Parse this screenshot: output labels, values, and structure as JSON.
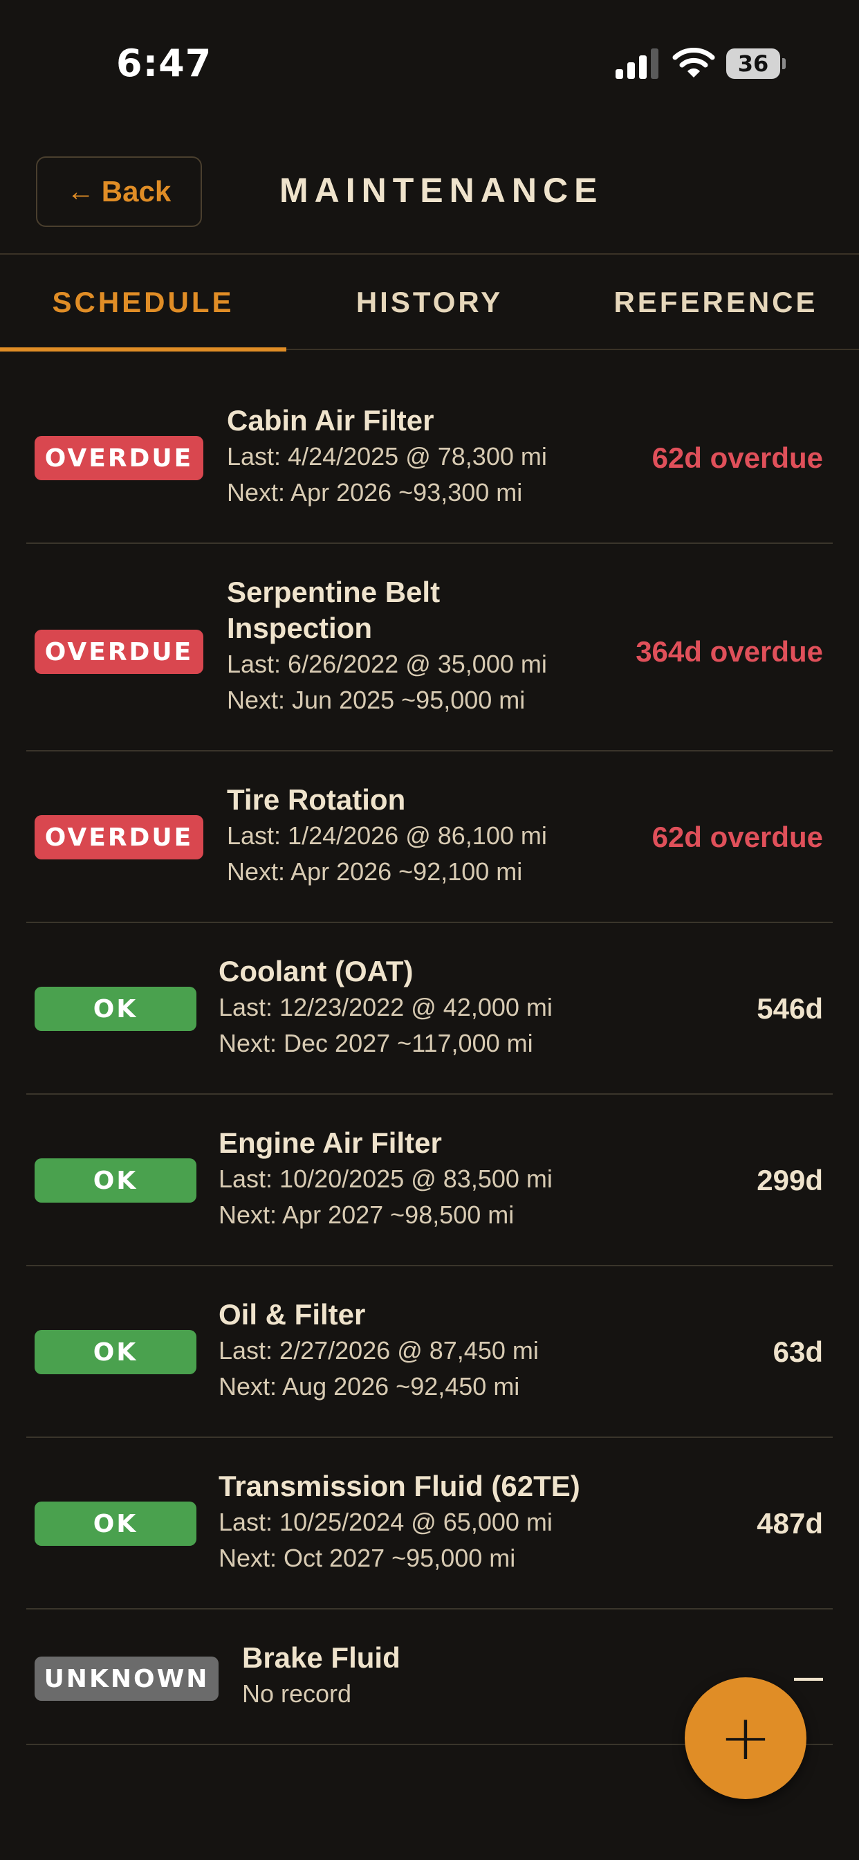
{
  "status_bar": {
    "time": "6:47",
    "battery": "36"
  },
  "header": {
    "back_label": "Back",
    "back_arrow": "←",
    "title": "MAINTENANCE"
  },
  "tabs": [
    {
      "label": "SCHEDULE"
    },
    {
      "label": "HISTORY"
    },
    {
      "label": "REFERENCE"
    }
  ],
  "items": [
    {
      "badge": "OVERDUE",
      "title": "Cabin Air Filter",
      "last": "Last: 4/24/2025 @ 78,300 mi",
      "next": "Next: Apr 2026 ~93,300 mi",
      "status": "62d overdue"
    },
    {
      "badge": "OVERDUE",
      "title": "Serpentine Belt",
      "title2": "Inspection",
      "last": "Last: 6/26/2022 @ 35,000 mi",
      "next": "Next: Jun 2025 ~95,000 mi",
      "status": "364d overdue"
    },
    {
      "badge": "OVERDUE",
      "title": "Tire Rotation",
      "last": "Last: 1/24/2026 @ 86,100 mi",
      "next": "Next: Apr 2026 ~92,100 mi",
      "status": "62d overdue"
    },
    {
      "badge": "OK",
      "title": "Coolant (OAT)",
      "last": "Last: 12/23/2022 @ 42,000 mi",
      "next": "Next: Dec 2027 ~117,000 mi",
      "status": "546d"
    },
    {
      "badge": "OK",
      "title": "Engine Air Filter",
      "last": "Last: 10/20/2025 @ 83,500 mi",
      "next": "Next: Apr 2027 ~98,500 mi",
      "status": "299d"
    },
    {
      "badge": "OK",
      "title": "Oil & Filter",
      "last": "Last: 2/27/2026 @ 87,450 mi",
      "next": "Next: Aug 2026 ~92,450 mi",
      "status": "63d"
    },
    {
      "badge": "OK",
      "title": "Transmission Fluid (62TE)",
      "last": "Last: 10/25/2024 @ 65,000 mi",
      "next": "Next: Oct 2027 ~95,000 mi",
      "status": "487d"
    },
    {
      "badge": "UNKNOWN",
      "title": "Brake Fluid",
      "last": "No record",
      "status": "—"
    }
  ],
  "fab": {
    "icon": "plus-icon",
    "symbol": "+"
  },
  "colors": {
    "accent": "#e08d26",
    "overdue": "#d9474f",
    "ok": "#4aa14e",
    "unknown": "#6b6b6b",
    "background": "#151311"
  }
}
